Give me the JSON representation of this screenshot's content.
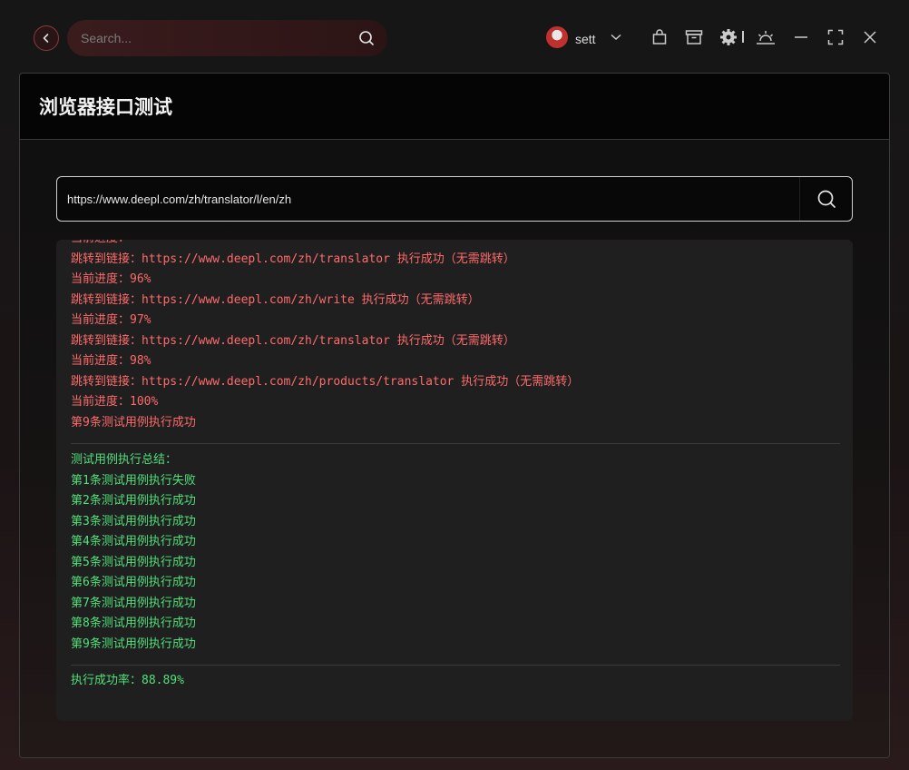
{
  "header": {
    "search_placeholder": "Search...",
    "user_name": "sett"
  },
  "panel": {
    "title": "浏览器接口测试",
    "url_value": "https://www.deepl.com/zh/translator/l/en/zh"
  },
  "log": {
    "cut_line": "当前进度：",
    "run_lines": [
      "跳转到链接：https://www.deepl.com/zh/translator 执行成功（无需跳转）",
      "当前进度：96%",
      "跳转到链接：https://www.deepl.com/zh/write 执行成功（无需跳转）",
      "当前进度：97%",
      "跳转到链接：https://www.deepl.com/zh/translator 执行成功（无需跳转）",
      "当前进度：98%",
      "跳转到链接：https://www.deepl.com/zh/products/translator 执行成功（无需跳转）",
      "当前进度：100%",
      "第9条测试用例执行成功"
    ],
    "summary_lines": [
      "测试用例执行总结：",
      "第1条测试用例执行失败",
      "第2条测试用例执行成功",
      "第3条测试用例执行成功",
      "第4条测试用例执行成功",
      "第5条测试用例执行成功",
      "第6条测试用例执行成功",
      "第7条测试用例执行成功",
      "第8条测试用例执行成功",
      "第9条测试用例执行成功"
    ],
    "success_rate": "执行成功率：88.89%"
  },
  "colors": {
    "error_text": "#ff6b6b",
    "success_text": "#52e07a",
    "accent": "#8a3a3a"
  },
  "icons": [
    "back-arrow-icon",
    "search-icon",
    "chevron-down-icon",
    "shopping-bag-icon",
    "archive-icon",
    "gear-icon",
    "sunrise-icon",
    "minimize-icon",
    "maximize-icon",
    "close-icon"
  ]
}
